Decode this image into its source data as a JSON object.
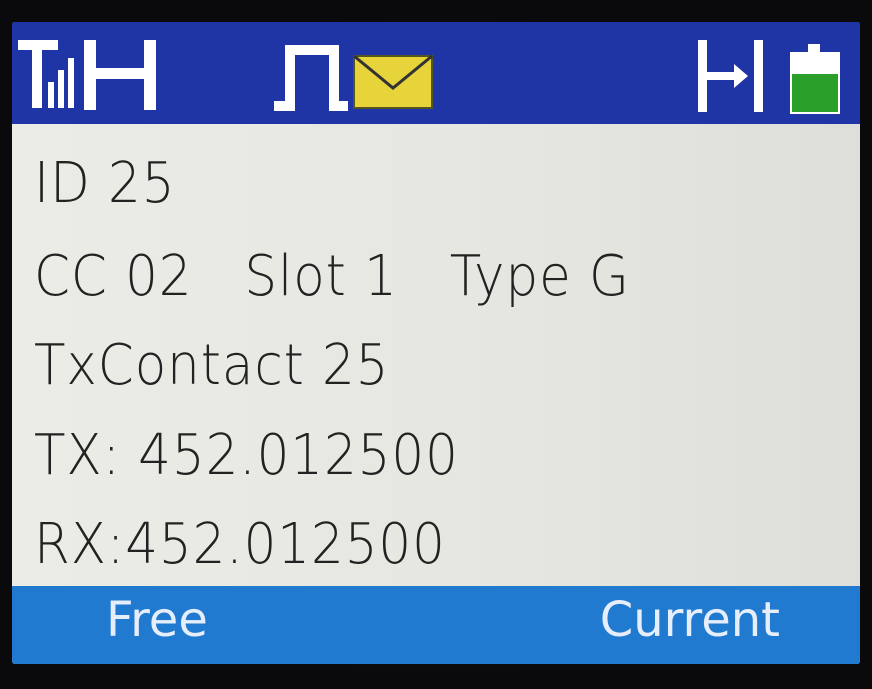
{
  "status_bar": {
    "icons": [
      "signal-strength-icon",
      "h-channel-icon",
      "pulse-icon",
      "message-envelope-icon",
      "transfer-icon",
      "battery-icon"
    ],
    "background_color": "#1f35a6",
    "envelope_color": "#e6d43a",
    "battery_color": "#2aa02a"
  },
  "info": {
    "id_line": "ID 25",
    "cc_label": "CC 02",
    "slot_label": "Slot 1",
    "type_label": "Type G",
    "contact_line": "TxContact 25",
    "tx_line": "TX: 452.012500",
    "rx_line": "RX:452.012500"
  },
  "softkeys": {
    "left": "Free",
    "right": "Current",
    "bar_color": "#1f7ad0"
  }
}
